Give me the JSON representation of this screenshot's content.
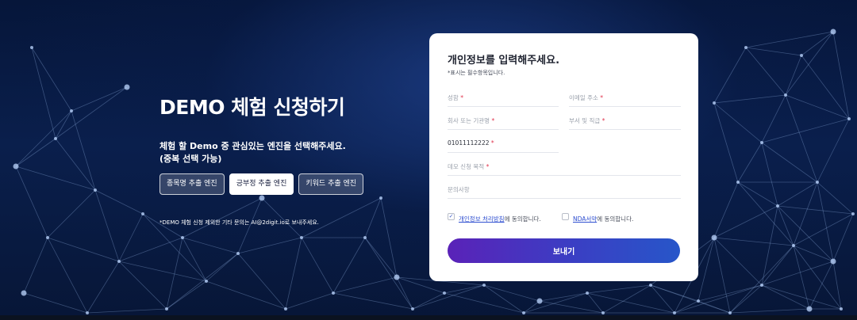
{
  "hero": {
    "title": "DEMO 체험 신청하기",
    "desc_line1": "체험 할 Demo 중 관심있는 엔진을 선택해주세요.",
    "desc_line2": "(중복 선택 가능)",
    "engines": [
      {
        "label": "종목명 추출 엔진",
        "selected": false
      },
      {
        "label": "긍부정 추출 엔진",
        "selected": true
      },
      {
        "label": "키워드 추출 엔진",
        "selected": false
      }
    ],
    "note": "*DEMO 체험 신청 제외한 기타 문의는 AI@2digit.io로 보내주세요."
  },
  "form": {
    "title": "개인정보를 입력해주세요.",
    "subtitle": "*표시는 필수항목입니다.",
    "required_mark": "*",
    "fields": {
      "name": {
        "placeholder": "성함",
        "value": ""
      },
      "email": {
        "placeholder": "이메일 주소",
        "value": ""
      },
      "company": {
        "placeholder": "회사 또는 기관명",
        "value": ""
      },
      "dept": {
        "placeholder": "부서 및 직급",
        "value": ""
      },
      "phone": {
        "placeholder": "",
        "value": "01011112222"
      },
      "purpose": {
        "placeholder": "데모 신청 목적",
        "value": ""
      },
      "inquiry": {
        "placeholder": "문의사항",
        "value": ""
      }
    },
    "agree_privacy": {
      "checked": true,
      "check_mark": "✓",
      "link": "개인정보 처리방침",
      "suffix": "에 동의합니다."
    },
    "agree_nda": {
      "checked": false,
      "check_mark": "",
      "link": "NDA서약",
      "suffix": "에 동의합니다."
    },
    "submit_label": "보내기"
  },
  "colors": {
    "accent_start": "#5a22b8",
    "accent_end": "#2756c9",
    "required": "#e0334c",
    "link": "#2f4fd0"
  }
}
